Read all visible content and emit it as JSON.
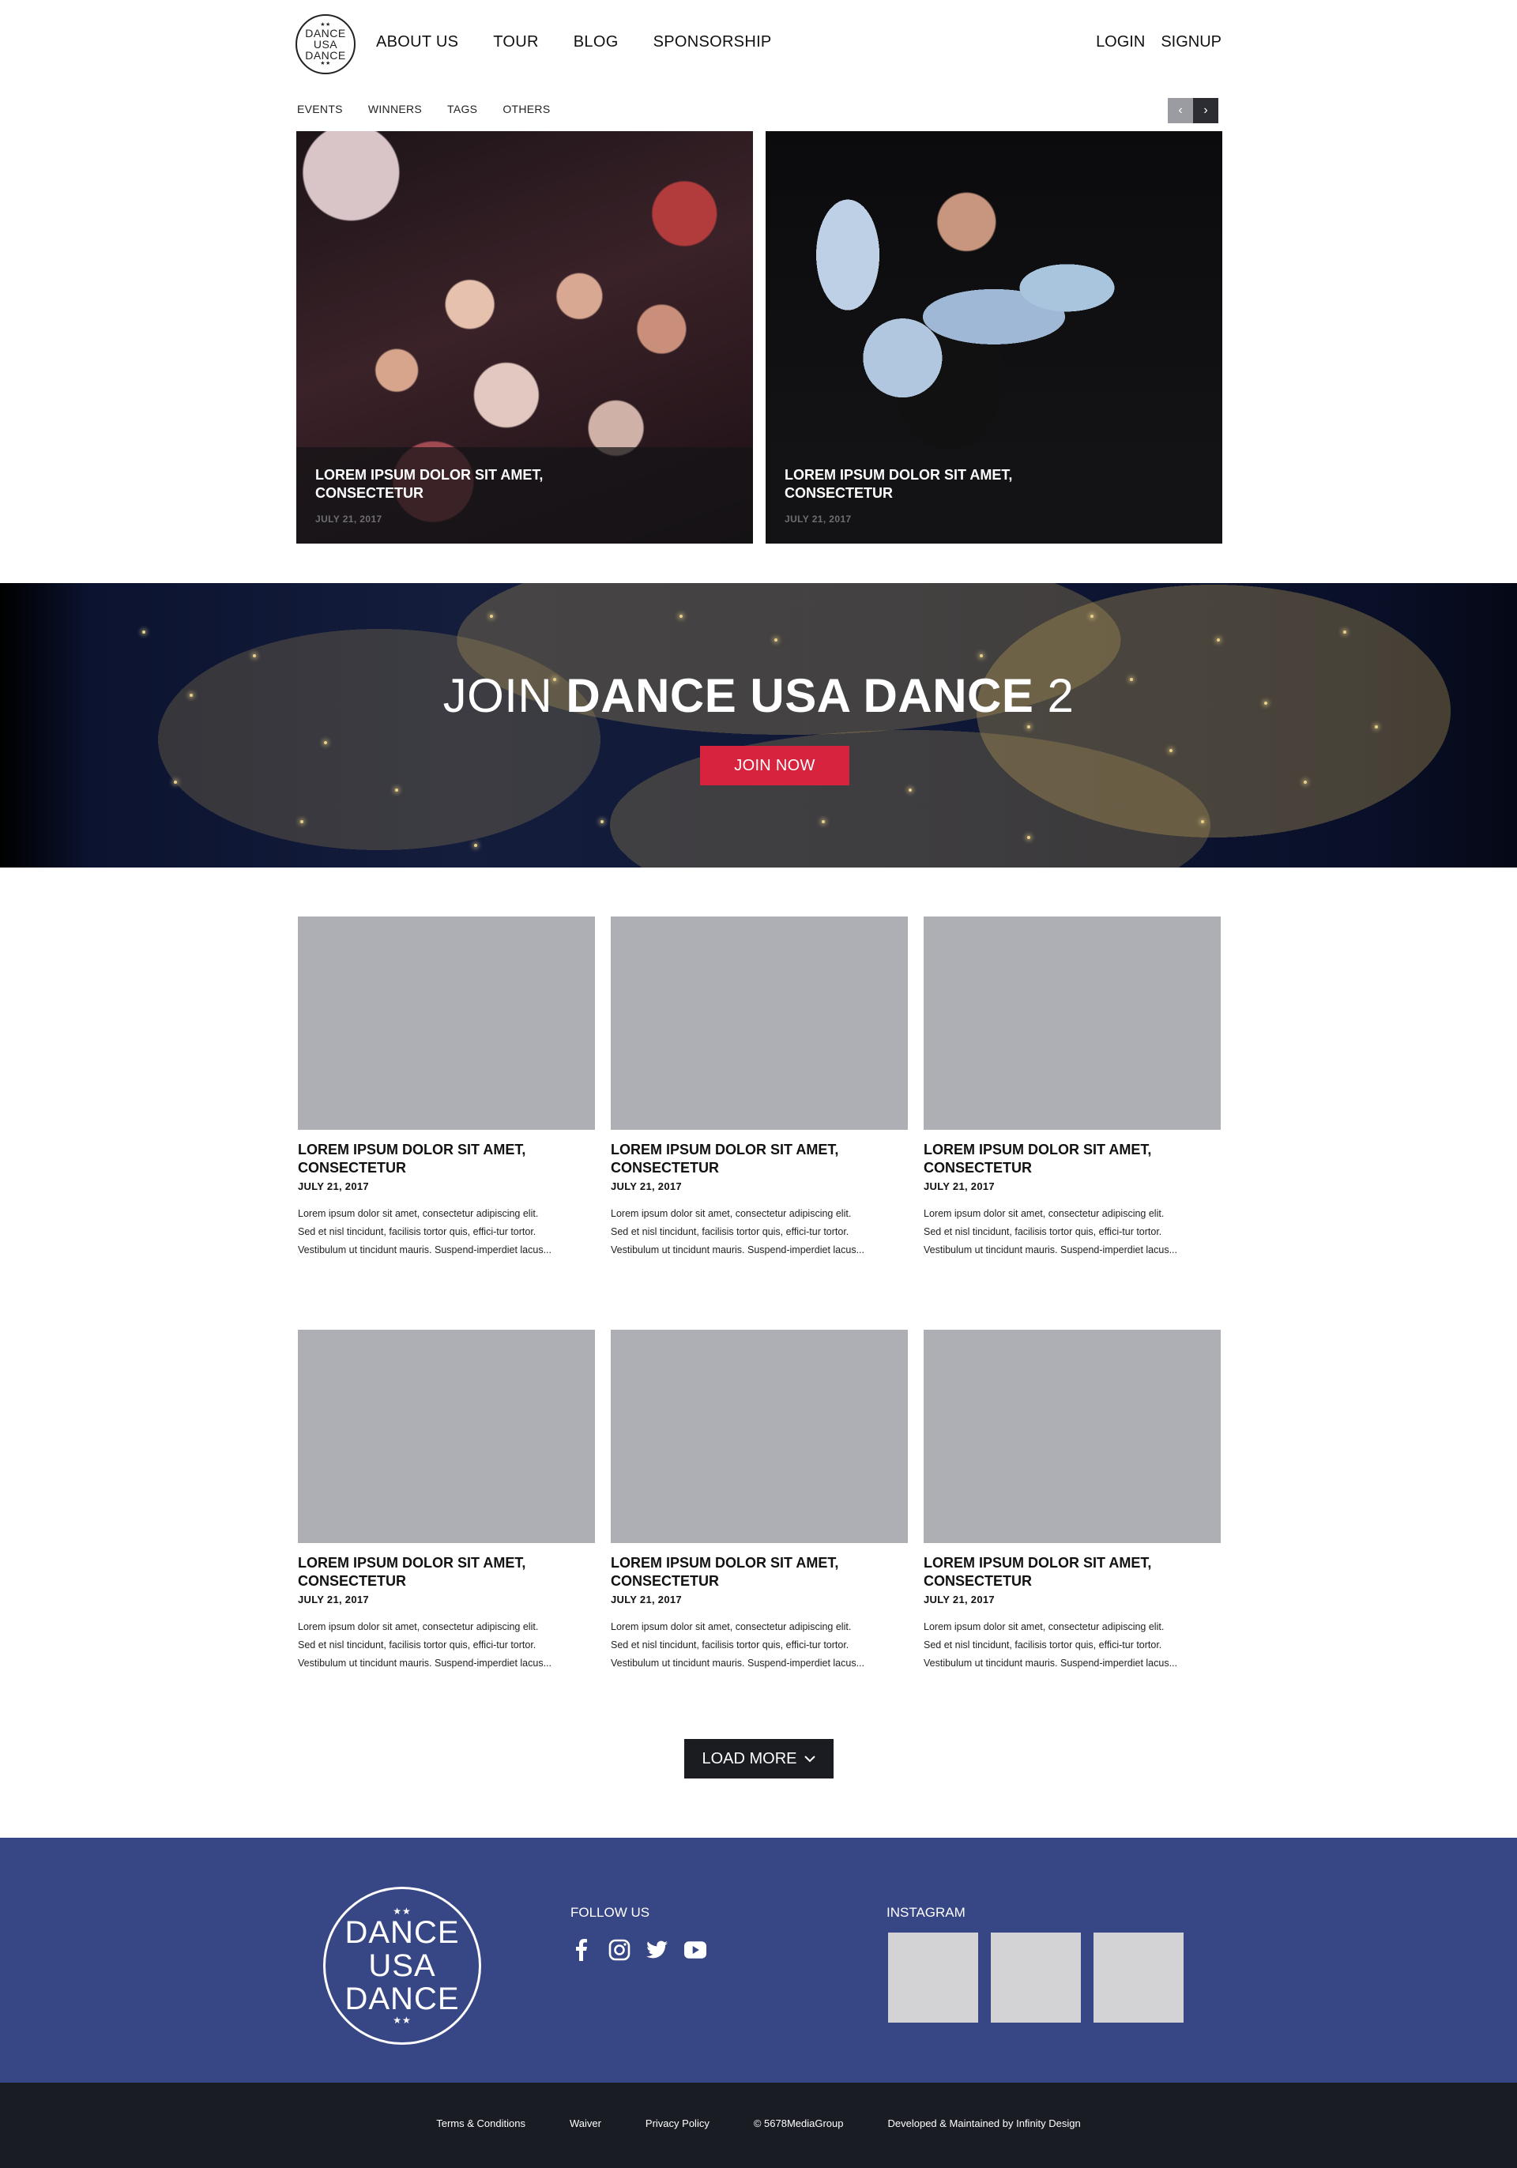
{
  "header": {
    "logo_lines": [
      "DANCE",
      "USA",
      "DANCE"
    ],
    "nav": [
      "ABOUT US",
      "TOUR",
      "BLOG",
      "SPONSORSHIP"
    ],
    "login": "LOGIN",
    "signup": "SIGNUP"
  },
  "subnav": [
    "EVENTS",
    "WINNERS",
    "TAGS",
    "OTHERS"
  ],
  "featured": [
    {
      "title": "LOREM IPSUM DOLOR SIT AMET, CONSECTETUR",
      "date": "JULY 21, 2017"
    },
    {
      "title": "LOREM IPSUM DOLOR SIT AMET, CONSECTETUR",
      "date": "JULY 21, 2017"
    }
  ],
  "join": {
    "prefix": "JOIN ",
    "brand": "DANCE USA DANCE",
    "suffix": " 2",
    "button": "JOIN NOW"
  },
  "posts": [
    {
      "title": "LOREM IPSUM DOLOR SIT AMET, CONSECTETUR",
      "date": "JULY 21, 2017",
      "body": "Lorem ipsum dolor sit amet, consectetur adipiscing elit. Sed et nisl tincidunt, facilisis tortor quis, effici-tur tortor. Vestibulum ut tincidunt mauris. Suspend-imperdiet lacus..."
    },
    {
      "title": "LOREM IPSUM DOLOR SIT AMET, CONSECTETUR",
      "date": "JULY 21, 2017",
      "body": "Lorem ipsum dolor sit amet, consectetur adipiscing elit. Sed et nisl tincidunt, facilisis tortor quis, effici-tur tortor. Vestibulum ut tincidunt mauris. Suspend-imperdiet lacus..."
    },
    {
      "title": "LOREM IPSUM DOLOR SIT AMET, CONSECTETUR",
      "date": "JULY 21, 2017",
      "body": "Lorem ipsum dolor sit amet, consectetur adipiscing elit. Sed et nisl tincidunt, facilisis tortor quis, effici-tur tortor. Vestibulum ut tincidunt mauris. Suspend-imperdiet lacus..."
    },
    {
      "title": "LOREM IPSUM DOLOR SIT AMET, CONSECTETUR",
      "date": "JULY 21, 2017",
      "body": "Lorem ipsum dolor sit amet, consectetur adipiscing elit. Sed et nisl tincidunt, facilisis tortor quis, effici-tur tortor. Vestibulum ut tincidunt mauris. Suspend-imperdiet lacus..."
    },
    {
      "title": "LOREM IPSUM DOLOR SIT AMET, CONSECTETUR",
      "date": "JULY 21, 2017",
      "body": "Lorem ipsum dolor sit amet, consectetur adipiscing elit. Sed et nisl tincidunt, facilisis tortor quis, effici-tur tortor. Vestibulum ut tincidunt mauris. Suspend-imperdiet lacus..."
    },
    {
      "title": "LOREM IPSUM DOLOR SIT AMET, CONSECTETUR",
      "date": "JULY 21, 2017",
      "body": "Lorem ipsum dolor sit amet, consectetur adipiscing elit. Sed et nisl tincidunt, facilisis tortor quis, effici-tur tortor. Vestibulum ut tincidunt mauris. Suspend-imperdiet lacus..."
    }
  ],
  "load_more": "LOAD MORE",
  "footer": {
    "logo_lines": [
      "DANCE",
      "USA",
      "DANCE"
    ],
    "follow_label": "FOLLOW US",
    "social_icons": [
      "facebook-icon",
      "instagram-icon",
      "twitter-icon",
      "youtube-icon"
    ],
    "instagram_label": "INSTAGRAM",
    "links": [
      "Terms & Conditions",
      "Waiver",
      "Privacy Policy",
      "© 5678MediaGroup",
      "Developed & Maintained by Infinity Design"
    ]
  },
  "colors": {
    "accent_red": "#d8233f",
    "footer_blue": "#374684",
    "bottom_bar": "#1a1c24",
    "placeholder_gray": "#adafb4"
  }
}
